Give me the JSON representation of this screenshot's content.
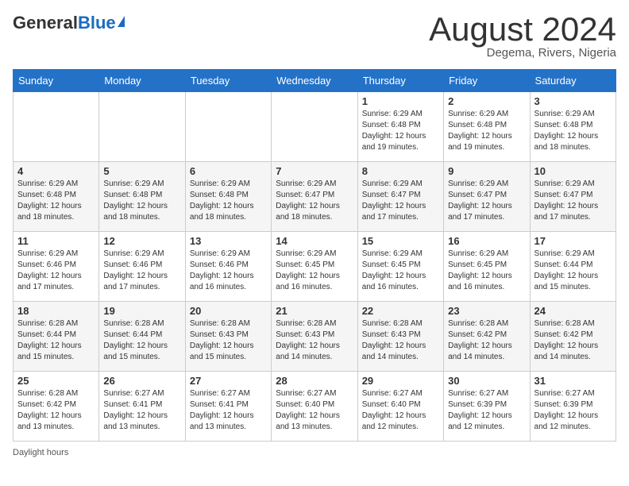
{
  "header": {
    "logo_general": "General",
    "logo_blue": "Blue",
    "month_title": "August 2024",
    "location": "Degema, Rivers, Nigeria"
  },
  "footer": {
    "daylight_label": "Daylight hours"
  },
  "days_of_week": [
    "Sunday",
    "Monday",
    "Tuesday",
    "Wednesday",
    "Thursday",
    "Friday",
    "Saturday"
  ],
  "weeks": [
    [
      {
        "day": "",
        "detail": ""
      },
      {
        "day": "",
        "detail": ""
      },
      {
        "day": "",
        "detail": ""
      },
      {
        "day": "",
        "detail": ""
      },
      {
        "day": "1",
        "detail": "Sunrise: 6:29 AM\nSunset: 6:48 PM\nDaylight: 12 hours\nand 19 minutes."
      },
      {
        "day": "2",
        "detail": "Sunrise: 6:29 AM\nSunset: 6:48 PM\nDaylight: 12 hours\nand 19 minutes."
      },
      {
        "day": "3",
        "detail": "Sunrise: 6:29 AM\nSunset: 6:48 PM\nDaylight: 12 hours\nand 18 minutes."
      }
    ],
    [
      {
        "day": "4",
        "detail": "Sunrise: 6:29 AM\nSunset: 6:48 PM\nDaylight: 12 hours\nand 18 minutes."
      },
      {
        "day": "5",
        "detail": "Sunrise: 6:29 AM\nSunset: 6:48 PM\nDaylight: 12 hours\nand 18 minutes."
      },
      {
        "day": "6",
        "detail": "Sunrise: 6:29 AM\nSunset: 6:48 PM\nDaylight: 12 hours\nand 18 minutes."
      },
      {
        "day": "7",
        "detail": "Sunrise: 6:29 AM\nSunset: 6:47 PM\nDaylight: 12 hours\nand 18 minutes."
      },
      {
        "day": "8",
        "detail": "Sunrise: 6:29 AM\nSunset: 6:47 PM\nDaylight: 12 hours\nand 17 minutes."
      },
      {
        "day": "9",
        "detail": "Sunrise: 6:29 AM\nSunset: 6:47 PM\nDaylight: 12 hours\nand 17 minutes."
      },
      {
        "day": "10",
        "detail": "Sunrise: 6:29 AM\nSunset: 6:47 PM\nDaylight: 12 hours\nand 17 minutes."
      }
    ],
    [
      {
        "day": "11",
        "detail": "Sunrise: 6:29 AM\nSunset: 6:46 PM\nDaylight: 12 hours\nand 17 minutes."
      },
      {
        "day": "12",
        "detail": "Sunrise: 6:29 AM\nSunset: 6:46 PM\nDaylight: 12 hours\nand 17 minutes."
      },
      {
        "day": "13",
        "detail": "Sunrise: 6:29 AM\nSunset: 6:46 PM\nDaylight: 12 hours\nand 16 minutes."
      },
      {
        "day": "14",
        "detail": "Sunrise: 6:29 AM\nSunset: 6:45 PM\nDaylight: 12 hours\nand 16 minutes."
      },
      {
        "day": "15",
        "detail": "Sunrise: 6:29 AM\nSunset: 6:45 PM\nDaylight: 12 hours\nand 16 minutes."
      },
      {
        "day": "16",
        "detail": "Sunrise: 6:29 AM\nSunset: 6:45 PM\nDaylight: 12 hours\nand 16 minutes."
      },
      {
        "day": "17",
        "detail": "Sunrise: 6:29 AM\nSunset: 6:44 PM\nDaylight: 12 hours\nand 15 minutes."
      }
    ],
    [
      {
        "day": "18",
        "detail": "Sunrise: 6:28 AM\nSunset: 6:44 PM\nDaylight: 12 hours\nand 15 minutes."
      },
      {
        "day": "19",
        "detail": "Sunrise: 6:28 AM\nSunset: 6:44 PM\nDaylight: 12 hours\nand 15 minutes."
      },
      {
        "day": "20",
        "detail": "Sunrise: 6:28 AM\nSunset: 6:43 PM\nDaylight: 12 hours\nand 15 minutes."
      },
      {
        "day": "21",
        "detail": "Sunrise: 6:28 AM\nSunset: 6:43 PM\nDaylight: 12 hours\nand 14 minutes."
      },
      {
        "day": "22",
        "detail": "Sunrise: 6:28 AM\nSunset: 6:43 PM\nDaylight: 12 hours\nand 14 minutes."
      },
      {
        "day": "23",
        "detail": "Sunrise: 6:28 AM\nSunset: 6:42 PM\nDaylight: 12 hours\nand 14 minutes."
      },
      {
        "day": "24",
        "detail": "Sunrise: 6:28 AM\nSunset: 6:42 PM\nDaylight: 12 hours\nand 14 minutes."
      }
    ],
    [
      {
        "day": "25",
        "detail": "Sunrise: 6:28 AM\nSunset: 6:42 PM\nDaylight: 12 hours\nand 13 minutes."
      },
      {
        "day": "26",
        "detail": "Sunrise: 6:27 AM\nSunset: 6:41 PM\nDaylight: 12 hours\nand 13 minutes."
      },
      {
        "day": "27",
        "detail": "Sunrise: 6:27 AM\nSunset: 6:41 PM\nDaylight: 12 hours\nand 13 minutes."
      },
      {
        "day": "28",
        "detail": "Sunrise: 6:27 AM\nSunset: 6:40 PM\nDaylight: 12 hours\nand 13 minutes."
      },
      {
        "day": "29",
        "detail": "Sunrise: 6:27 AM\nSunset: 6:40 PM\nDaylight: 12 hours\nand 12 minutes."
      },
      {
        "day": "30",
        "detail": "Sunrise: 6:27 AM\nSunset: 6:39 PM\nDaylight: 12 hours\nand 12 minutes."
      },
      {
        "day": "31",
        "detail": "Sunrise: 6:27 AM\nSunset: 6:39 PM\nDaylight: 12 hours\nand 12 minutes."
      }
    ]
  ]
}
